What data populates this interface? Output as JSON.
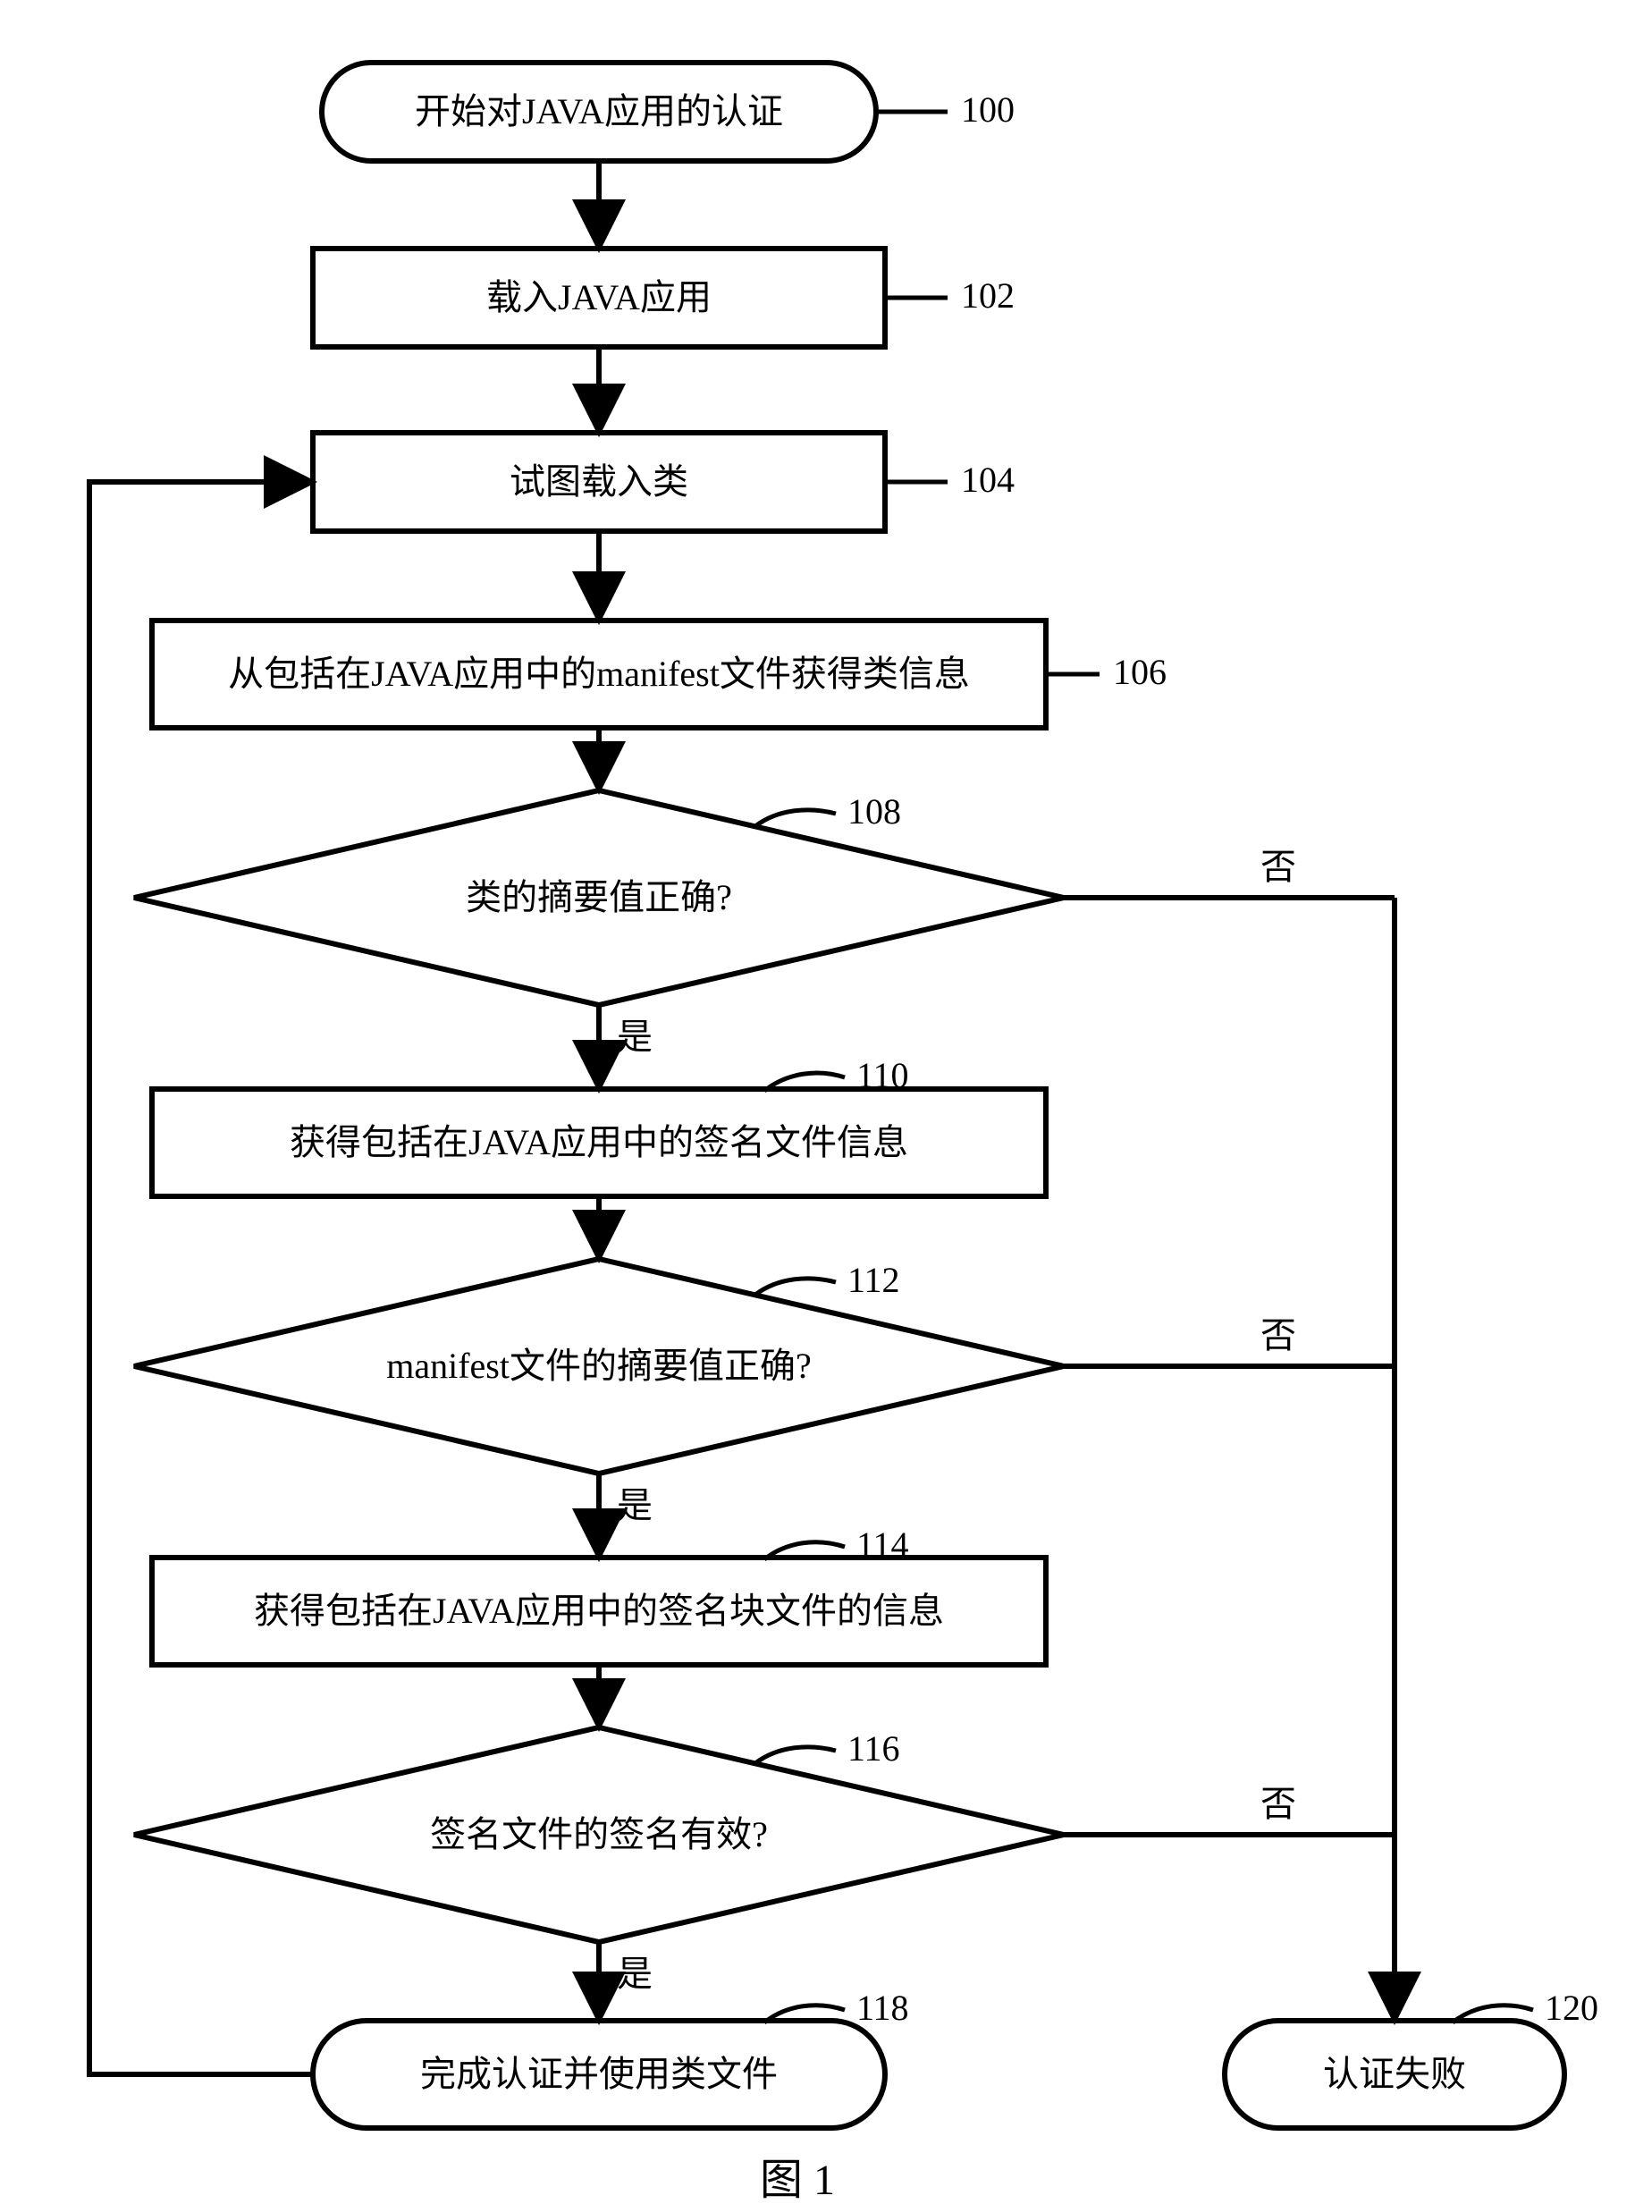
{
  "chart_data": {
    "type": "flowchart",
    "nodes": [
      {
        "id": "100",
        "kind": "terminator",
        "text": "开始对JAVA应用的认证"
      },
      {
        "id": "102",
        "kind": "process",
        "text": "载入JAVA应用"
      },
      {
        "id": "104",
        "kind": "process",
        "text": "试图载入类"
      },
      {
        "id": "106",
        "kind": "process",
        "text": "从包括在JAVA应用中的manifest文件获得类信息"
      },
      {
        "id": "108",
        "kind": "decision",
        "text": "类的摘要值正确?"
      },
      {
        "id": "110",
        "kind": "process",
        "text": "获得包括在JAVA应用中的签名文件信息"
      },
      {
        "id": "112",
        "kind": "decision",
        "text": "manifest文件的摘要值正确?"
      },
      {
        "id": "114",
        "kind": "process",
        "text": "获得包括在JAVA应用中的签名块文件的信息"
      },
      {
        "id": "116",
        "kind": "decision",
        "text": "签名文件的签名有效?"
      },
      {
        "id": "118",
        "kind": "terminator",
        "text": "完成认证并使用类文件"
      },
      {
        "id": "120",
        "kind": "terminator",
        "text": "认证失败"
      }
    ],
    "edges": [
      {
        "from": "100",
        "to": "102",
        "label": ""
      },
      {
        "from": "102",
        "to": "104",
        "label": ""
      },
      {
        "from": "104",
        "to": "106",
        "label": ""
      },
      {
        "from": "106",
        "to": "108",
        "label": ""
      },
      {
        "from": "108",
        "to": "110",
        "label": "是"
      },
      {
        "from": "108",
        "to": "120",
        "label": "否"
      },
      {
        "from": "110",
        "to": "112",
        "label": ""
      },
      {
        "from": "112",
        "to": "114",
        "label": "是"
      },
      {
        "from": "112",
        "to": "120",
        "label": "否"
      },
      {
        "from": "114",
        "to": "116",
        "label": ""
      },
      {
        "from": "116",
        "to": "118",
        "label": "是"
      },
      {
        "from": "116",
        "to": "120",
        "label": "否"
      },
      {
        "from": "118",
        "to": "104",
        "label": ""
      }
    ],
    "caption": "图 1"
  },
  "nodes": {
    "n100": {
      "text": "开始对JAVA应用的认证",
      "label": "100"
    },
    "n102": {
      "text": "载入JAVA应用",
      "label": "102"
    },
    "n104": {
      "text": "试图载入类",
      "label": "104"
    },
    "n106": {
      "text": "从包括在JAVA应用中的manifest文件获得类信息",
      "label": "106"
    },
    "n108": {
      "text": "类的摘要值正确?",
      "label": "108"
    },
    "n110": {
      "text": "获得包括在JAVA应用中的签名文件信息",
      "label": "110"
    },
    "n112": {
      "text": "manifest文件的摘要值正确?",
      "label": "112"
    },
    "n114": {
      "text": "获得包括在JAVA应用中的签名块文件的信息",
      "label": "114"
    },
    "n116": {
      "text": "签名文件的签名有效?",
      "label": "116"
    },
    "n118": {
      "text": "完成认证并使用类文件",
      "label": "118"
    },
    "n120": {
      "text": "认证失败",
      "label": "120"
    }
  },
  "edge_labels": {
    "yes": "是",
    "no": "否"
  },
  "caption": "图 1"
}
